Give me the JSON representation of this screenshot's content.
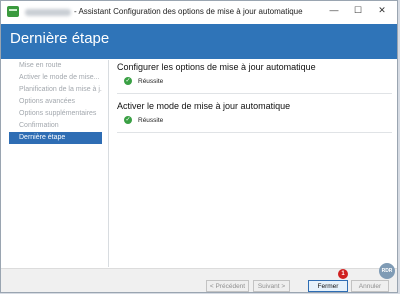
{
  "window": {
    "title": "- Assistant Configuration des options de mise à jour automatique",
    "controls": {
      "minimize": "—",
      "maximize": "☐",
      "close": "✕"
    }
  },
  "header": {
    "title": "Dernière étape"
  },
  "sidebar": {
    "items": [
      {
        "label": "Mise en route",
        "state": "disabled"
      },
      {
        "label": "Activer le mode de mise...",
        "state": "disabled"
      },
      {
        "label": "Planification de la mise à j...",
        "state": "disabled"
      },
      {
        "label": "Options avancées",
        "state": "disabled"
      },
      {
        "label": "Options supplémentaires",
        "state": "disabled"
      },
      {
        "label": "Confirmation",
        "state": "disabled"
      },
      {
        "label": "Dernière étape",
        "state": "active"
      }
    ]
  },
  "tasks": [
    {
      "title": "Configurer les options de mise à jour automatique",
      "status": "Réussite",
      "icon": "check-icon"
    },
    {
      "title": "Activer le mode de mise à jour automatique",
      "status": "Réussite",
      "icon": "check-icon"
    }
  ],
  "footer": {
    "prev_label": "< Précédent",
    "next_label": "Suivant >",
    "close_label": "Fermer",
    "cancel_label": "Annuler"
  },
  "annotations": {
    "badge": "1",
    "watermark": "RDR"
  },
  "colors": {
    "accent": "#2f74b8",
    "success": "#3aa044",
    "badge": "#d0201f"
  }
}
